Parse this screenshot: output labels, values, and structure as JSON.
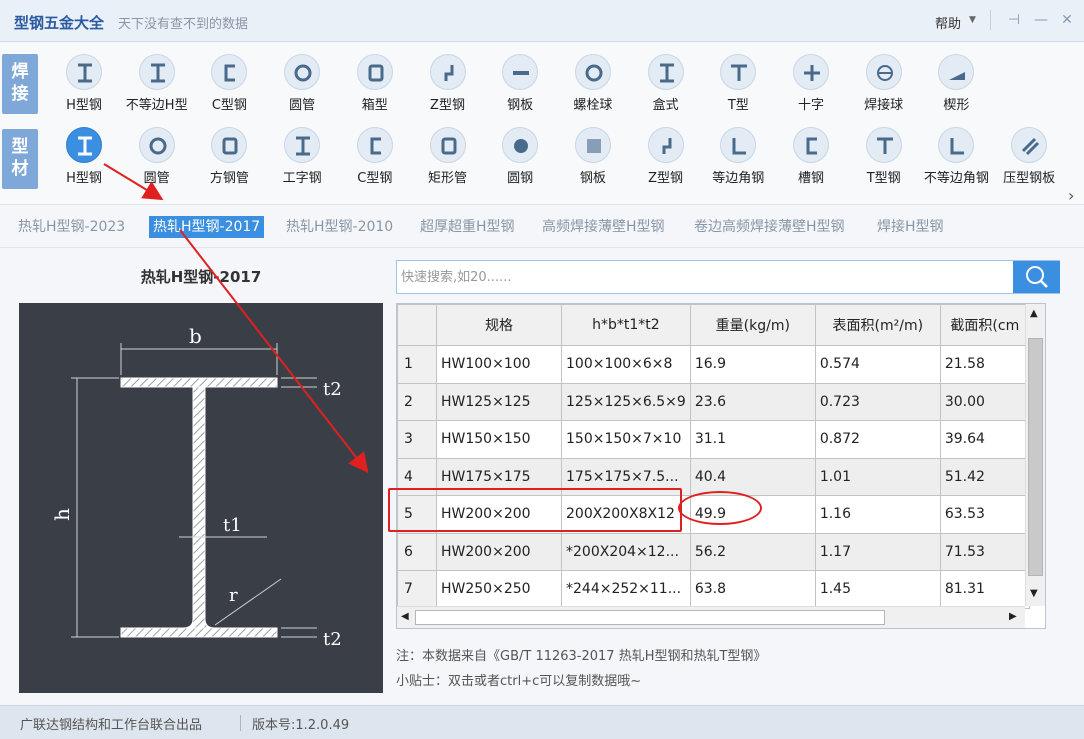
{
  "titlebar": {
    "title": "型钢五金大全",
    "subtitle": "天下没有查不到的数据",
    "help": "帮助"
  },
  "sidebar": {
    "tab_weld_1": "焊",
    "tab_weld_2": "接",
    "tab_section_1": "型",
    "tab_section_2": "材"
  },
  "weld_tools": [
    "H型钢",
    "不等边H型",
    "C型钢",
    "圆管",
    "箱型",
    "Z型钢",
    "钢板",
    "螺栓球",
    "盒式",
    "T型",
    "十字",
    "焊接球",
    "楔形"
  ],
  "section_tools": [
    "H型钢",
    "圆管",
    "方钢管",
    "工字钢",
    "C型钢",
    "矩形管",
    "圆钢",
    "钢板",
    "Z型钢",
    "等边角钢",
    "槽钢",
    "T型钢",
    "不等边角钢",
    "压型钢板"
  ],
  "categories": [
    "热轧H型钢-2023",
    "热轧H型钢-2017",
    "热轧H型钢-2010",
    "超厚超重H型钢",
    "高频焊接薄壁H型钢",
    "卷边高频焊接薄壁H型钢",
    "焊接H型钢"
  ],
  "diagram": {
    "title": "热轧H型钢-2017",
    "label_b": "b",
    "label_h": "h",
    "label_t1": "t1",
    "label_t2_top": "t2",
    "label_t2_bot": "t2",
    "label_r": "r"
  },
  "search": {
    "placeholder": "快速搜索,如20......"
  },
  "table": {
    "headers": [
      "规格",
      "h*b*t1*t2",
      "重量(kg/m)",
      "表面积(m²/m)",
      "截面积(cm"
    ],
    "rows": [
      [
        "1",
        "HW100×100",
        "100×100×6×8",
        "16.9",
        "0.574",
        "21.58"
      ],
      [
        "2",
        "HW125×125",
        "125×125×6.5×9",
        "23.6",
        "0.723",
        "30.00"
      ],
      [
        "3",
        "HW150×150",
        "150×150×7×10",
        "31.1",
        "0.872",
        "39.64"
      ],
      [
        "4",
        "HW175×175",
        "175×175×7.5...",
        "40.4",
        "1.01",
        "51.42"
      ],
      [
        "5",
        "HW200×200",
        "200X200X8X12",
        "49.9",
        "1.16",
        "63.53"
      ],
      [
        "6",
        "HW200×200",
        "*200X204×12...",
        "56.2",
        "1.17",
        "71.53"
      ],
      [
        "7",
        "HW250×250",
        "*244×252×11...",
        "63.8",
        "1.45",
        "81.31"
      ]
    ]
  },
  "notes": {
    "source": "注：本数据来自《GB/T 11263-2017 热轧H型钢和热轧T型钢》",
    "tip": "小贴士：双击或者ctrl+c可以复制数据哦~"
  },
  "status": {
    "publisher": "广联达钢结构和工作台联合出品",
    "version": "版本号:1.2.0.49"
  },
  "colors": {
    "accent": "#3b8fe0",
    "annotation": "#e02020",
    "diagram_bg": "#3a3f47"
  }
}
